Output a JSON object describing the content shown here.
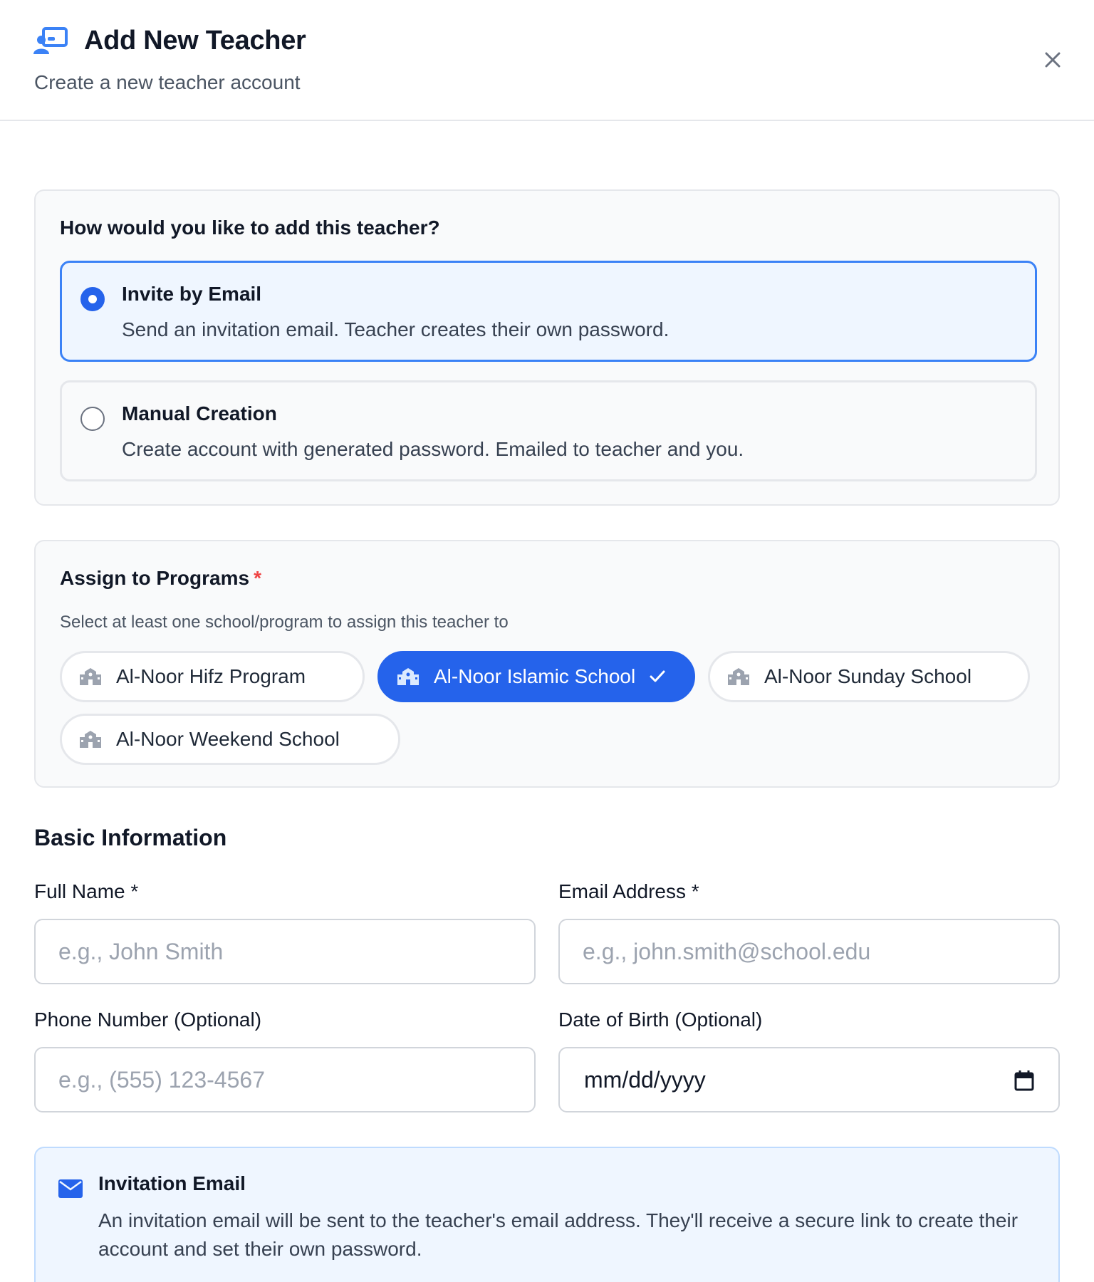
{
  "header": {
    "title": "Add New Teacher",
    "subtitle": "Create a new teacher account",
    "icon": "teacher-icon",
    "close_icon": "close-icon"
  },
  "method": {
    "heading": "How would you like to add this teacher?",
    "options": [
      {
        "title": "Invite by Email",
        "description": "Send an invitation email. Teacher creates their own password.",
        "selected": true
      },
      {
        "title": "Manual Creation",
        "description": "Create account with generated password. Emailed to teacher and you.",
        "selected": false
      }
    ]
  },
  "programs": {
    "heading": "Assign to Programs",
    "required_mark": "*",
    "help": "Select at least one school/program to assign this teacher to",
    "items": [
      {
        "label": "Al-Noor Hifz Program",
        "selected": false
      },
      {
        "label": "Al-Noor Islamic School",
        "selected": true
      },
      {
        "label": "Al-Noor Sunday School",
        "selected": false
      },
      {
        "label": "Al-Noor Weekend School",
        "selected": false
      }
    ]
  },
  "basic": {
    "title": "Basic Information",
    "full_name": {
      "label": "Full Name *",
      "placeholder": "e.g., John Smith",
      "value": ""
    },
    "email": {
      "label": "Email Address *",
      "placeholder": "e.g., john.smith@school.edu",
      "value": ""
    },
    "phone": {
      "label": "Phone Number (Optional)",
      "placeholder": "e.g., (555) 123-4567",
      "value": ""
    },
    "dob": {
      "label": "Date of Birth (Optional)",
      "display": "mm/dd/yyyy"
    }
  },
  "info": {
    "title": "Invitation Email",
    "text": "An invitation email will be sent to the teacher's email address. They'll receive a secure link to create their account and set their own password."
  },
  "colors": {
    "accent": "#2563eb",
    "accent_light": "#eff6ff",
    "required": "#ef4444"
  }
}
